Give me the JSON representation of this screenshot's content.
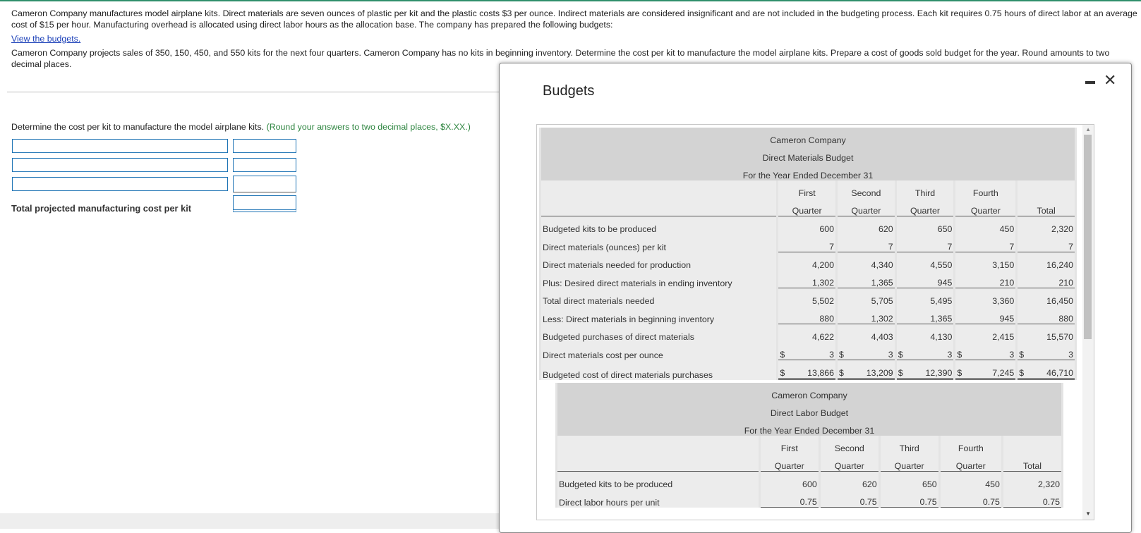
{
  "problem": {
    "paragraph1": "Cameron Company manufactures model airplane kits. Direct materials are seven ounces of plastic per kit and the plastic costs $3 per ounce. Indirect materials are considered insignificant and are not included in the budgeting process. Each kit requires 0.75 hours of direct labor at an average cost of $15 per hour. Manufacturing overhead is allocated using direct labor hours as the allocation base. The company has prepared the following budgets:",
    "link_text": "View the budgets.",
    "paragraph2": "Cameron Company projects sales of 350, 150, 450, and 550 kits for the next four quarters. Cameron Company has no kits in beginning inventory. Determine the cost per kit to manufacture the model airplane kits. Prepare a cost of goods sold budget for the year. Round amounts to two decimal places."
  },
  "question": {
    "text": "Determine the cost per kit to manufacture the model airplane kits. ",
    "hint": "(Round your answers to two decimal places, $X.XX.)",
    "total_label": "Total projected manufacturing cost per kit",
    "rows": [
      {
        "label_value": "",
        "amount_value": ""
      },
      {
        "label_value": "",
        "amount_value": ""
      },
      {
        "label_value": "",
        "amount_value": ""
      }
    ],
    "total_value": ""
  },
  "modal": {
    "title": "Budgets",
    "minimize_icon": "minimize-icon",
    "close_glyph": "✕"
  },
  "dm_budget": {
    "company": "Cameron Company",
    "name": "Direct Materials Budget",
    "period": "For the Year Ended December 31",
    "col_top": [
      "First",
      "Second",
      "Third",
      "Fourth",
      ""
    ],
    "col_bottom": [
      "Quarter",
      "Quarter",
      "Quarter",
      "Quarter",
      "Total"
    ],
    "rows": [
      {
        "label": "Budgeted kits to be produced",
        "cur": false,
        "values": [
          "600",
          "620",
          "650",
          "450",
          "2,320"
        ]
      },
      {
        "label": "Direct materials (ounces) per kit",
        "cur": false,
        "values": [
          "7",
          "7",
          "7",
          "7",
          "7"
        ]
      },
      {
        "label": "Direct materials needed for production",
        "cur": false,
        "values": [
          "4,200",
          "4,340",
          "4,550",
          "3,150",
          "16,240"
        ]
      },
      {
        "label": "Plus: Desired direct materials in ending inventory",
        "cur": false,
        "values": [
          "1,302",
          "1,365",
          "945",
          "210",
          "210"
        ]
      },
      {
        "label": "Total direct materials needed",
        "cur": false,
        "values": [
          "5,502",
          "5,705",
          "5,495",
          "3,360",
          "16,450"
        ]
      },
      {
        "label": "Less: Direct materials in beginning inventory",
        "cur": false,
        "values": [
          "880",
          "1,302",
          "1,365",
          "945",
          "880"
        ]
      },
      {
        "label": "Budgeted purchases of direct materials",
        "cur": false,
        "values": [
          "4,622",
          "4,403",
          "4,130",
          "2,415",
          "15,570"
        ]
      },
      {
        "label": "Direct materials cost per ounce",
        "cur": true,
        "values": [
          "3",
          "3",
          "3",
          "3",
          "3"
        ]
      },
      {
        "label": "Budgeted cost of direct materials purchases",
        "cur": true,
        "values": [
          "13,866",
          "13,209",
          "12,390",
          "7,245",
          "46,710"
        ]
      }
    ],
    "currency_symbol": "$"
  },
  "dl_budget": {
    "company": "Cameron Company",
    "name": "Direct Labor Budget",
    "period": "For the Year Ended December 31",
    "col_top": [
      "First",
      "Second",
      "Third",
      "Fourth",
      ""
    ],
    "col_bottom": [
      "Quarter",
      "Quarter",
      "Quarter",
      "Quarter",
      "Total"
    ],
    "rows": [
      {
        "label": "Budgeted kits to be produced",
        "values": [
          "600",
          "620",
          "650",
          "450",
          "2,320"
        ]
      },
      {
        "label": "Direct labor hours per unit",
        "values": [
          "0.75",
          "0.75",
          "0.75",
          "0.75",
          "0.75"
        ]
      }
    ]
  },
  "colors": {
    "accent_line": "#2f8f6b",
    "input_border": "#1f74b5",
    "hint": "#2e8540",
    "link": "#1a3fb8"
  }
}
